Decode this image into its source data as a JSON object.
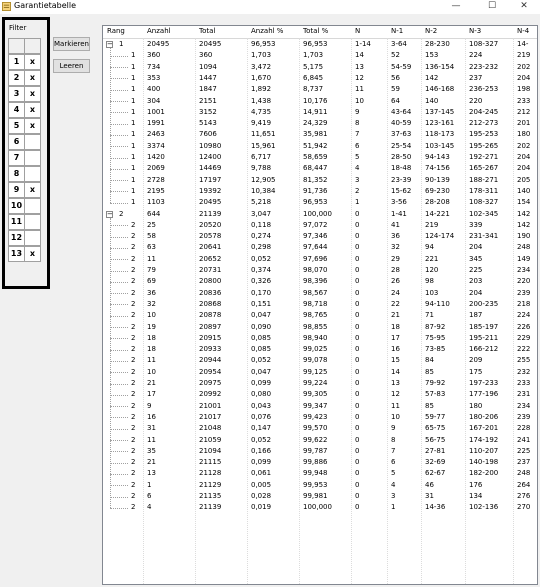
{
  "window": {
    "title": "Garantietabelle",
    "min": "—",
    "max": "☐",
    "close": "✕"
  },
  "filter": {
    "label": "Filter",
    "rows": [
      {
        "num": "1",
        "mark": "x"
      },
      {
        "num": "2",
        "mark": "x"
      },
      {
        "num": "3",
        "mark": "x"
      },
      {
        "num": "4",
        "mark": "x"
      },
      {
        "num": "5",
        "mark": "x"
      },
      {
        "num": "6",
        "mark": ""
      },
      {
        "num": "7",
        "mark": ""
      },
      {
        "num": "8",
        "mark": ""
      },
      {
        "num": "9",
        "mark": "x"
      },
      {
        "num": "10",
        "mark": ""
      },
      {
        "num": "11",
        "mark": ""
      },
      {
        "num": "12",
        "mark": ""
      },
      {
        "num": "13",
        "mark": "x"
      }
    ]
  },
  "buttons": {
    "markieren": "Markieren",
    "leeren": "Leeren"
  },
  "table": {
    "headers": [
      "Rang",
      "Anzahl",
      "Total",
      "Anzahl %",
      "Total %",
      "N",
      "N-1",
      "N-2",
      "N-3",
      "N-4"
    ],
    "rows": [
      {
        "lvl": 0,
        "exp": "−",
        "c": [
          "1",
          "20495",
          "20495",
          "96,953",
          "96,953",
          "1-14",
          "3-64",
          "28-230",
          "108-327",
          "14-"
        ]
      },
      {
        "lvl": 1,
        "c": [
          "1",
          "360",
          "360",
          "1,703",
          "1,703",
          "14",
          "52",
          "153",
          "224",
          "219"
        ]
      },
      {
        "lvl": 1,
        "c": [
          "1",
          "734",
          "1094",
          "3,472",
          "5,175",
          "13",
          "54-59",
          "136-154",
          "223-232",
          "202"
        ]
      },
      {
        "lvl": 1,
        "c": [
          "1",
          "353",
          "1447",
          "1,670",
          "6,845",
          "12",
          "56",
          "142",
          "237",
          "204"
        ]
      },
      {
        "lvl": 1,
        "c": [
          "1",
          "400",
          "1847",
          "1,892",
          "8,737",
          "11",
          "59",
          "146-168",
          "236-253",
          "198"
        ]
      },
      {
        "lvl": 1,
        "c": [
          "1",
          "304",
          "2151",
          "1,438",
          "10,176",
          "10",
          "64",
          "140",
          "220",
          "233"
        ]
      },
      {
        "lvl": 1,
        "c": [
          "1",
          "1001",
          "3152",
          "4,735",
          "14,911",
          "9",
          "43-64",
          "137-145",
          "204-245",
          "212"
        ]
      },
      {
        "lvl": 1,
        "c": [
          "1",
          "1991",
          "5143",
          "9,419",
          "24,329",
          "8",
          "40-59",
          "123-161",
          "212-273",
          "201"
        ]
      },
      {
        "lvl": 1,
        "c": [
          "1",
          "2463",
          "7606",
          "11,651",
          "35,981",
          "7",
          "37-63",
          "118-173",
          "195-253",
          "180"
        ]
      },
      {
        "lvl": 1,
        "c": [
          "1",
          "3374",
          "10980",
          "15,961",
          "51,942",
          "6",
          "25-54",
          "103-145",
          "195-265",
          "202"
        ]
      },
      {
        "lvl": 1,
        "c": [
          "1",
          "1420",
          "12400",
          "6,717",
          "58,659",
          "5",
          "28-50",
          "94-143",
          "192-271",
          "204"
        ]
      },
      {
        "lvl": 1,
        "c": [
          "1",
          "2069",
          "14469",
          "9,788",
          "68,447",
          "4",
          "18-48",
          "74-156",
          "165-267",
          "204"
        ]
      },
      {
        "lvl": 1,
        "c": [
          "1",
          "2728",
          "17197",
          "12,905",
          "81,352",
          "3",
          "23-39",
          "90-139",
          "188-271",
          "205"
        ]
      },
      {
        "lvl": 1,
        "c": [
          "1",
          "2195",
          "19392",
          "10,384",
          "91,736",
          "2",
          "15-62",
          "69-230",
          "178-311",
          "140"
        ]
      },
      {
        "lvl": 1,
        "c": [
          "1",
          "1103",
          "20495",
          "5,218",
          "96,953",
          "1",
          "3-56",
          "28-208",
          "108-327",
          "154"
        ]
      },
      {
        "lvl": 0,
        "exp": "−",
        "c": [
          "2",
          "644",
          "21139",
          "3,047",
          "100,000",
          "0",
          "1-41",
          "14-221",
          "102-345",
          "142"
        ]
      },
      {
        "lvl": 1,
        "c": [
          "2",
          "25",
          "20520",
          "0,118",
          "97,072",
          "0",
          "41",
          "219",
          "339",
          "142"
        ]
      },
      {
        "lvl": 1,
        "c": [
          "2",
          "58",
          "20578",
          "0,274",
          "97,346",
          "0",
          "36",
          "124-174",
          "231-341",
          "190"
        ]
      },
      {
        "lvl": 1,
        "c": [
          "2",
          "63",
          "20641",
          "0,298",
          "97,644",
          "0",
          "32",
          "94",
          "204",
          "248"
        ]
      },
      {
        "lvl": 1,
        "c": [
          "2",
          "11",
          "20652",
          "0,052",
          "97,696",
          "0",
          "29",
          "221",
          "345",
          "149"
        ]
      },
      {
        "lvl": 1,
        "c": [
          "2",
          "79",
          "20731",
          "0,374",
          "98,070",
          "0",
          "28",
          "120",
          "225",
          "234"
        ]
      },
      {
        "lvl": 1,
        "c": [
          "2",
          "69",
          "20800",
          "0,326",
          "98,396",
          "0",
          "26",
          "98",
          "203",
          "220"
        ]
      },
      {
        "lvl": 1,
        "c": [
          "2",
          "36",
          "20836",
          "0,170",
          "98,567",
          "0",
          "24",
          "103",
          "204",
          "239"
        ]
      },
      {
        "lvl": 1,
        "c": [
          "2",
          "32",
          "20868",
          "0,151",
          "98,718",
          "0",
          "22",
          "94-110",
          "200-235",
          "218"
        ]
      },
      {
        "lvl": 1,
        "c": [
          "2",
          "10",
          "20878",
          "0,047",
          "98,765",
          "0",
          "21",
          "71",
          "187",
          "224"
        ]
      },
      {
        "lvl": 1,
        "c": [
          "2",
          "19",
          "20897",
          "0,090",
          "98,855",
          "0",
          "18",
          "87-92",
          "185-197",
          "226"
        ]
      },
      {
        "lvl": 1,
        "c": [
          "2",
          "18",
          "20915",
          "0,085",
          "98,940",
          "0",
          "17",
          "75-95",
          "195-211",
          "229"
        ]
      },
      {
        "lvl": 1,
        "c": [
          "2",
          "18",
          "20933",
          "0,085",
          "99,025",
          "0",
          "16",
          "73-85",
          "166-212",
          "222"
        ]
      },
      {
        "lvl": 1,
        "c": [
          "2",
          "11",
          "20944",
          "0,052",
          "99,078",
          "0",
          "15",
          "84",
          "209",
          "255"
        ]
      },
      {
        "lvl": 1,
        "c": [
          "2",
          "10",
          "20954",
          "0,047",
          "99,125",
          "0",
          "14",
          "85",
          "175",
          "232"
        ]
      },
      {
        "lvl": 1,
        "c": [
          "2",
          "21",
          "20975",
          "0,099",
          "99,224",
          "0",
          "13",
          "79-92",
          "197-233",
          "233"
        ]
      },
      {
        "lvl": 1,
        "c": [
          "2",
          "17",
          "20992",
          "0,080",
          "99,305",
          "0",
          "12",
          "57-83",
          "177-196",
          "231"
        ]
      },
      {
        "lvl": 1,
        "c": [
          "2",
          "9",
          "21001",
          "0,043",
          "99,347",
          "0",
          "11",
          "85",
          "180",
          "234"
        ]
      },
      {
        "lvl": 1,
        "c": [
          "2",
          "16",
          "21017",
          "0,076",
          "99,423",
          "0",
          "10",
          "59-77",
          "180-206",
          "239"
        ]
      },
      {
        "lvl": 1,
        "c": [
          "2",
          "31",
          "21048",
          "0,147",
          "99,570",
          "0",
          "9",
          "65-75",
          "167-201",
          "228"
        ]
      },
      {
        "lvl": 1,
        "c": [
          "2",
          "11",
          "21059",
          "0,052",
          "99,622",
          "0",
          "8",
          "56-75",
          "174-192",
          "241"
        ]
      },
      {
        "lvl": 1,
        "c": [
          "2",
          "35",
          "21094",
          "0,166",
          "99,787",
          "0",
          "7",
          "27-81",
          "110-207",
          "225"
        ]
      },
      {
        "lvl": 1,
        "c": [
          "2",
          "21",
          "21115",
          "0,099",
          "99,886",
          "0",
          "6",
          "32-69",
          "140-198",
          "237"
        ]
      },
      {
        "lvl": 1,
        "c": [
          "2",
          "13",
          "21128",
          "0,061",
          "99,948",
          "0",
          "5",
          "62-67",
          "182-200",
          "248"
        ]
      },
      {
        "lvl": 1,
        "c": [
          "2",
          "1",
          "21129",
          "0,005",
          "99,953",
          "0",
          "4",
          "46",
          "176",
          "264"
        ]
      },
      {
        "lvl": 1,
        "c": [
          "2",
          "6",
          "21135",
          "0,028",
          "99,981",
          "0",
          "3",
          "31",
          "134",
          "276"
        ]
      },
      {
        "lvl": 1,
        "c": [
          "2",
          "4",
          "21139",
          "0,019",
          "100,000",
          "0",
          "1",
          "14-36",
          "102-136",
          "270"
        ]
      }
    ]
  }
}
